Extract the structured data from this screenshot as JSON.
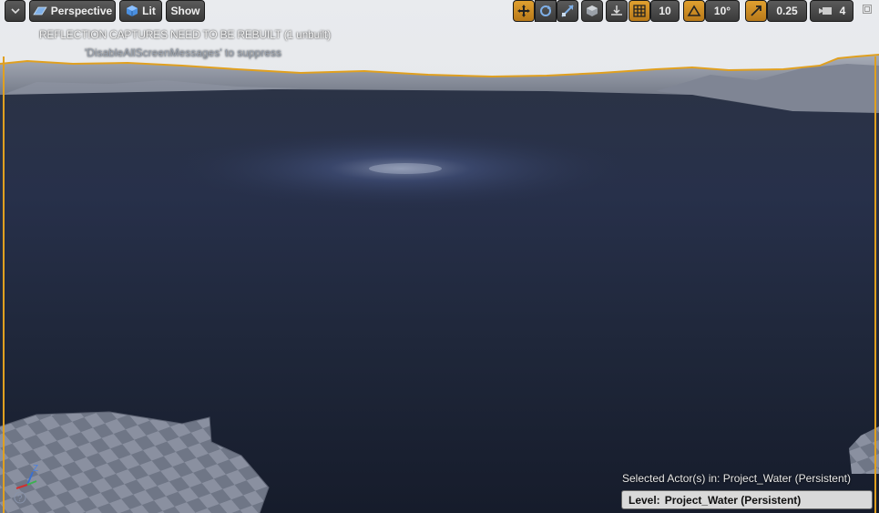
{
  "toolbar": {
    "dropdown_label": "",
    "perspective_label": "Perspective",
    "lit_label": "Lit",
    "show_label": "Show",
    "grid_snap_value": "10",
    "rotation_snap_value": "10°",
    "scale_snap_value": "0.25",
    "camera_speed_value": "4"
  },
  "messages": {
    "reflection_warning": "REFLECTION CAPTURES NEED TO BE REBUILT (1 unbuilt)",
    "suppress_hint": "'DisableAllScreenMessages' to suppress"
  },
  "status": {
    "selected_actor_text": "Selected Actor(s) in:  Project_Water (Persistent)",
    "level_label": "Level:",
    "level_value": "Project_Water (Persistent)"
  },
  "colors": {
    "accent": "#e0a020",
    "water": "#1d2436",
    "sky": "#e6e8ec"
  },
  "icons": {
    "transform_tools": [
      "translate-icon",
      "rotate-icon",
      "scale-icon",
      "world-local-icon",
      "surface-snap-icon",
      "grid-snap-icon",
      "rotation-snap-icon",
      "scale-snap-icon",
      "camera-speed-icon",
      "maximize-icon"
    ]
  }
}
